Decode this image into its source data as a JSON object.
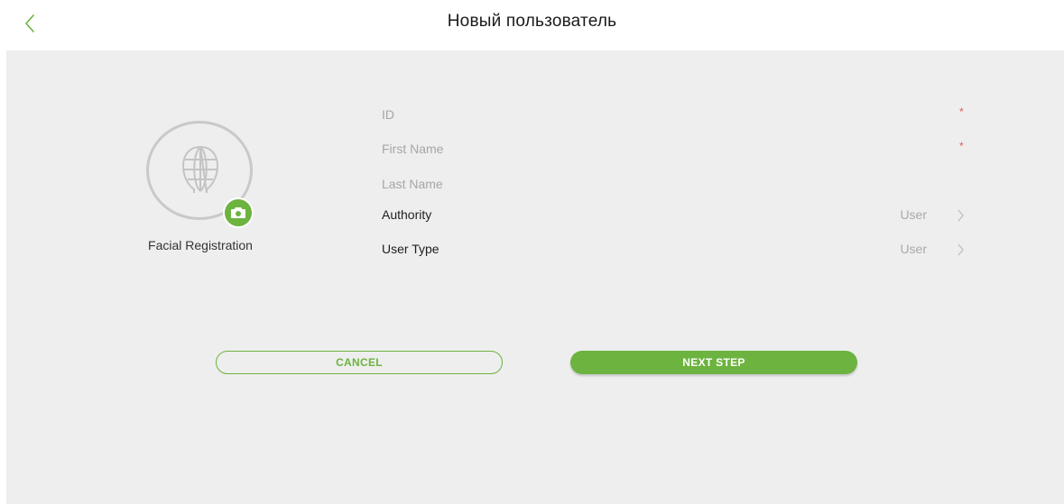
{
  "header": {
    "title": "Новый пользователь",
    "back_icon": "chevron-left-icon"
  },
  "face": {
    "label": "Facial Registration",
    "icon": "face-scan-icon",
    "badge_icon": "camera-icon"
  },
  "fields": [
    {
      "label": "ID",
      "required": "*"
    },
    {
      "label": "First Name",
      "required": "*"
    },
    {
      "label": "Last Name",
      "required": ""
    }
  ],
  "selects": [
    {
      "label": "Authority",
      "value": "User"
    },
    {
      "label": "User Type",
      "value": "User"
    }
  ],
  "buttons": {
    "cancel": "CANCEL",
    "next": "NEXT STEP"
  },
  "colors": {
    "accent": "#6db33f",
    "required": "#e05a5a",
    "background": "#eeeeee"
  }
}
